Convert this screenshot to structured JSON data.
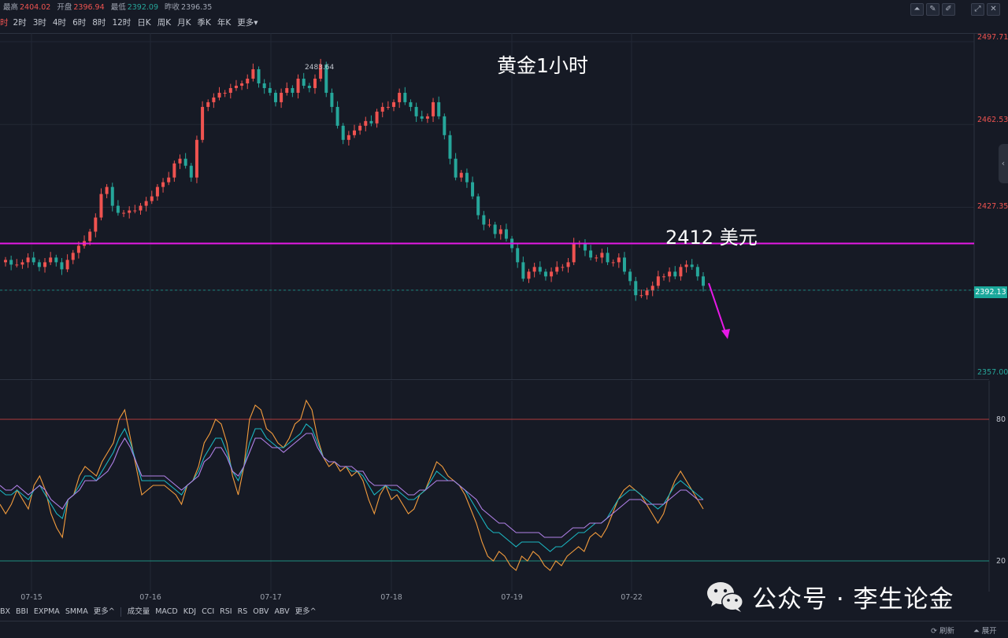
{
  "info": {
    "high_label": "最高",
    "high": "2404.02",
    "open_label": "开盘",
    "open": "2396.94",
    "low_label": "最低",
    "low": "2392.09",
    "prev_close_label": "昨收",
    "prev_close": "2396.35"
  },
  "periods": [
    {
      "label": "时",
      "active": true
    },
    {
      "label": "2时"
    },
    {
      "label": "3时"
    },
    {
      "label": "4时"
    },
    {
      "label": "6时"
    },
    {
      "label": "8时"
    },
    {
      "label": "12时"
    },
    {
      "label": "日K"
    },
    {
      "label": "周K"
    },
    {
      "label": "月K"
    },
    {
      "label": "季K"
    },
    {
      "label": "年K"
    },
    {
      "label": "更多▾"
    }
  ],
  "tools": [
    "line-chart-icon",
    "pencil-icon",
    "pencil-alt-icon",
    "expand-icon",
    "close-icon"
  ],
  "annotations": {
    "title": "黄金1小时",
    "level": "2412 美元",
    "high_marker": "2483.64"
  },
  "price_axis": {
    "ticks": [
      "2497.71",
      "2462.53",
      "2427.35",
      "2357.00"
    ],
    "current": "2392.13",
    "colors": {
      "up": "#ef5350",
      "down": "#26a69a",
      "current_bg": "#1aa89b"
    }
  },
  "osc_axis": {
    "ticks": [
      "80",
      "20"
    ]
  },
  "dates": [
    "07-15",
    "07-16",
    "07-17",
    "07-18",
    "07-19",
    "07-22"
  ],
  "indicators_main": [
    "BX",
    "BBI",
    "EXPMA",
    "SMMA",
    "更多^"
  ],
  "indicators_sub": [
    "成交量",
    "MACD",
    "KDJ",
    "CCI",
    "RSI",
    "RS",
    "OBV",
    "ABV",
    "更多^"
  ],
  "footer": {
    "refresh": "刷新",
    "expand": "展开"
  },
  "watermark": {
    "text": "公众号 · 李生论金"
  },
  "colors": {
    "level_line": "#e619e6",
    "bg": "#161a25",
    "up": "#ef5350",
    "down": "#26a69a"
  },
  "chart_data": [
    {
      "type": "candlestick",
      "title": "黄金1小时",
      "ylim": [
        2357.0,
        2505.0
      ],
      "x_labels": [
        "07-15",
        "07-16",
        "07-17",
        "07-18",
        "07-19",
        "07-22"
      ],
      "horizontal_lines": [
        {
          "value": 2412.0,
          "label": "2412 美元"
        }
      ],
      "close_trend": [
        2405,
        2403,
        2403,
        2404,
        2406,
        2404,
        2402,
        2404,
        2406,
        2404,
        2401,
        2405,
        2408,
        2411,
        2413,
        2417,
        2423,
        2433,
        2436,
        2428,
        2425,
        2425,
        2426,
        2426,
        2428,
        2430,
        2432,
        2436,
        2438,
        2440,
        2446,
        2448,
        2445,
        2440,
        2456,
        2470,
        2472,
        2474,
        2476,
        2476,
        2478,
        2479,
        2480,
        2482,
        2486,
        2480,
        2478,
        2476,
        2472,
        2476,
        2478,
        2476,
        2482,
        2479,
        2478,
        2482,
        2488,
        2476,
        2470,
        2462,
        2456,
        2458,
        2460,
        2462,
        2464,
        2463,
        2468,
        2470,
        2470,
        2472,
        2476,
        2472,
        2470,
        2466,
        2465,
        2466,
        2472,
        2466,
        2458,
        2448,
        2440,
        2442,
        2438,
        2432,
        2424,
        2420,
        2420,
        2416,
        2418,
        2414,
        2410,
        2404,
        2397,
        2400,
        2402,
        2400,
        2398,
        2400,
        2402,
        2402,
        2404,
        2412,
        2412,
        2409,
        2406,
        2406,
        2408,
        2404,
        2404,
        2406,
        2400,
        2396,
        2390,
        2390,
        2392,
        2394,
        2398,
        2398,
        2400,
        2398,
        2402,
        2403,
        2402,
        2398,
        2394
      ],
      "high_marker": 2483.64,
      "current_price": 2392.13
    },
    {
      "type": "line",
      "ylim": [
        0,
        100
      ],
      "reference_lines": [
        80,
        20
      ],
      "series": [
        {
          "color": "#f39c3d",
          "values": [
            44,
            40,
            44,
            50,
            46,
            42,
            52,
            56,
            50,
            40,
            34,
            30,
            46,
            48,
            56,
            60,
            58,
            56,
            62,
            66,
            70,
            80,
            84,
            72,
            60,
            48,
            50,
            52,
            52,
            52,
            50,
            48,
            44,
            52,
            54,
            60,
            70,
            74,
            80,
            78,
            70,
            56,
            48,
            60,
            80,
            86,
            84,
            76,
            74,
            70,
            68,
            72,
            78,
            80,
            88,
            84,
            72,
            64,
            60,
            62,
            58,
            60,
            56,
            58,
            54,
            46,
            40,
            48,
            52,
            46,
            48,
            44,
            40,
            42,
            48,
            50,
            56,
            62,
            60,
            56,
            54,
            52,
            48,
            42,
            36,
            28,
            22,
            20,
            24,
            22,
            18,
            16,
            22,
            20,
            24,
            22,
            18,
            16,
            20,
            18,
            22,
            24,
            26,
            24,
            30,
            32,
            30,
            34,
            40,
            46,
            50,
            52,
            50,
            48,
            44,
            40,
            36,
            40,
            48,
            54,
            58,
            54,
            50,
            46,
            42
          ]
        },
        {
          "color": "#1bb6c1",
          "values": [
            50,
            48,
            48,
            50,
            48,
            46,
            50,
            52,
            48,
            44,
            40,
            38,
            46,
            48,
            52,
            56,
            56,
            54,
            58,
            62,
            66,
            72,
            76,
            70,
            62,
            54,
            54,
            54,
            54,
            54,
            52,
            50,
            48,
            52,
            54,
            58,
            64,
            68,
            72,
            72,
            66,
            58,
            54,
            60,
            70,
            76,
            76,
            72,
            70,
            68,
            68,
            70,
            72,
            74,
            78,
            76,
            70,
            64,
            62,
            62,
            60,
            60,
            58,
            58,
            56,
            52,
            48,
            50,
            52,
            50,
            50,
            48,
            46,
            46,
            48,
            50,
            54,
            58,
            56,
            54,
            54,
            52,
            50,
            46,
            42,
            38,
            34,
            32,
            32,
            30,
            28,
            26,
            28,
            28,
            28,
            28,
            26,
            24,
            26,
            26,
            28,
            30,
            32,
            32,
            34,
            36,
            36,
            38,
            42,
            46,
            48,
            50,
            50,
            48,
            46,
            44,
            42,
            44,
            48,
            52,
            54,
            52,
            50,
            48,
            46
          ]
        },
        {
          "color": "#b181e8",
          "values": [
            52,
            50,
            50,
            52,
            50,
            48,
            50,
            52,
            50,
            46,
            44,
            42,
            46,
            48,
            50,
            54,
            54,
            54,
            56,
            58,
            62,
            68,
            72,
            68,
            62,
            56,
            56,
            56,
            56,
            56,
            54,
            52,
            50,
            52,
            54,
            56,
            62,
            64,
            68,
            68,
            64,
            58,
            56,
            60,
            66,
            72,
            72,
            70,
            68,
            68,
            66,
            68,
            70,
            72,
            74,
            74,
            68,
            64,
            62,
            62,
            60,
            60,
            60,
            58,
            58,
            54,
            52,
            52,
            52,
            52,
            52,
            50,
            48,
            48,
            50,
            50,
            52,
            54,
            54,
            54,
            54,
            52,
            50,
            48,
            46,
            42,
            40,
            38,
            36,
            36,
            34,
            32,
            32,
            32,
            32,
            32,
            30,
            30,
            30,
            30,
            32,
            34,
            34,
            34,
            36,
            36,
            36,
            38,
            40,
            42,
            44,
            46,
            46,
            46,
            44,
            44,
            44,
            44,
            46,
            48,
            50,
            50,
            48,
            46,
            46
          ]
        }
      ]
    }
  ]
}
